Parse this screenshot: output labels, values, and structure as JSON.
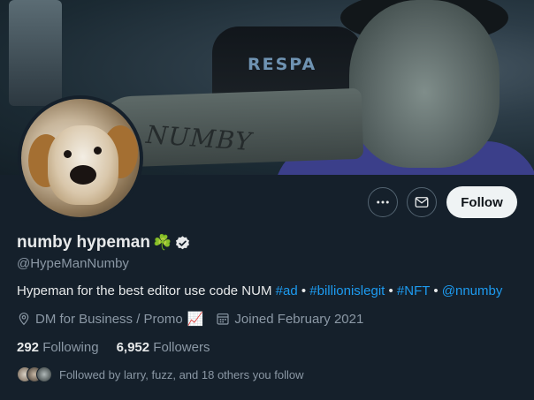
{
  "banner": {
    "chair_brand": "RESPA",
    "arm_text": "NUMBY"
  },
  "profile": {
    "display_name": "numby hypeman",
    "name_emoji": "☘️",
    "verified_icon": "verified-badge-icon",
    "handle": "@HypeManNumby",
    "bio": {
      "text_before": "Hypeman for the best editor use code NUM ",
      "tag_ad": "#ad",
      "sep1": " • ",
      "tag_billionislegit": "#billionislegit",
      "sep2": "  • ",
      "tag_nft": "#NFT",
      "sep3": " • ",
      "mention": "@nnumby"
    },
    "location": "DM for Business / Promo",
    "location_emoji": "📈",
    "joined": "Joined February 2021",
    "following_count": "292",
    "following_label": "Following",
    "followers_count": "6,952",
    "followers_label": "Followers",
    "followed_by": "Followed by larry, fuzz, and 18 others you follow"
  },
  "actions": {
    "more_icon": "more-horizontal-icon",
    "message_icon": "envelope-icon",
    "follow_label": "Follow"
  },
  "colors": {
    "background": "#15202b",
    "link": "#1d9bf0",
    "secondary_text": "#8b98a5",
    "follow_button_bg": "#eff3f4"
  }
}
